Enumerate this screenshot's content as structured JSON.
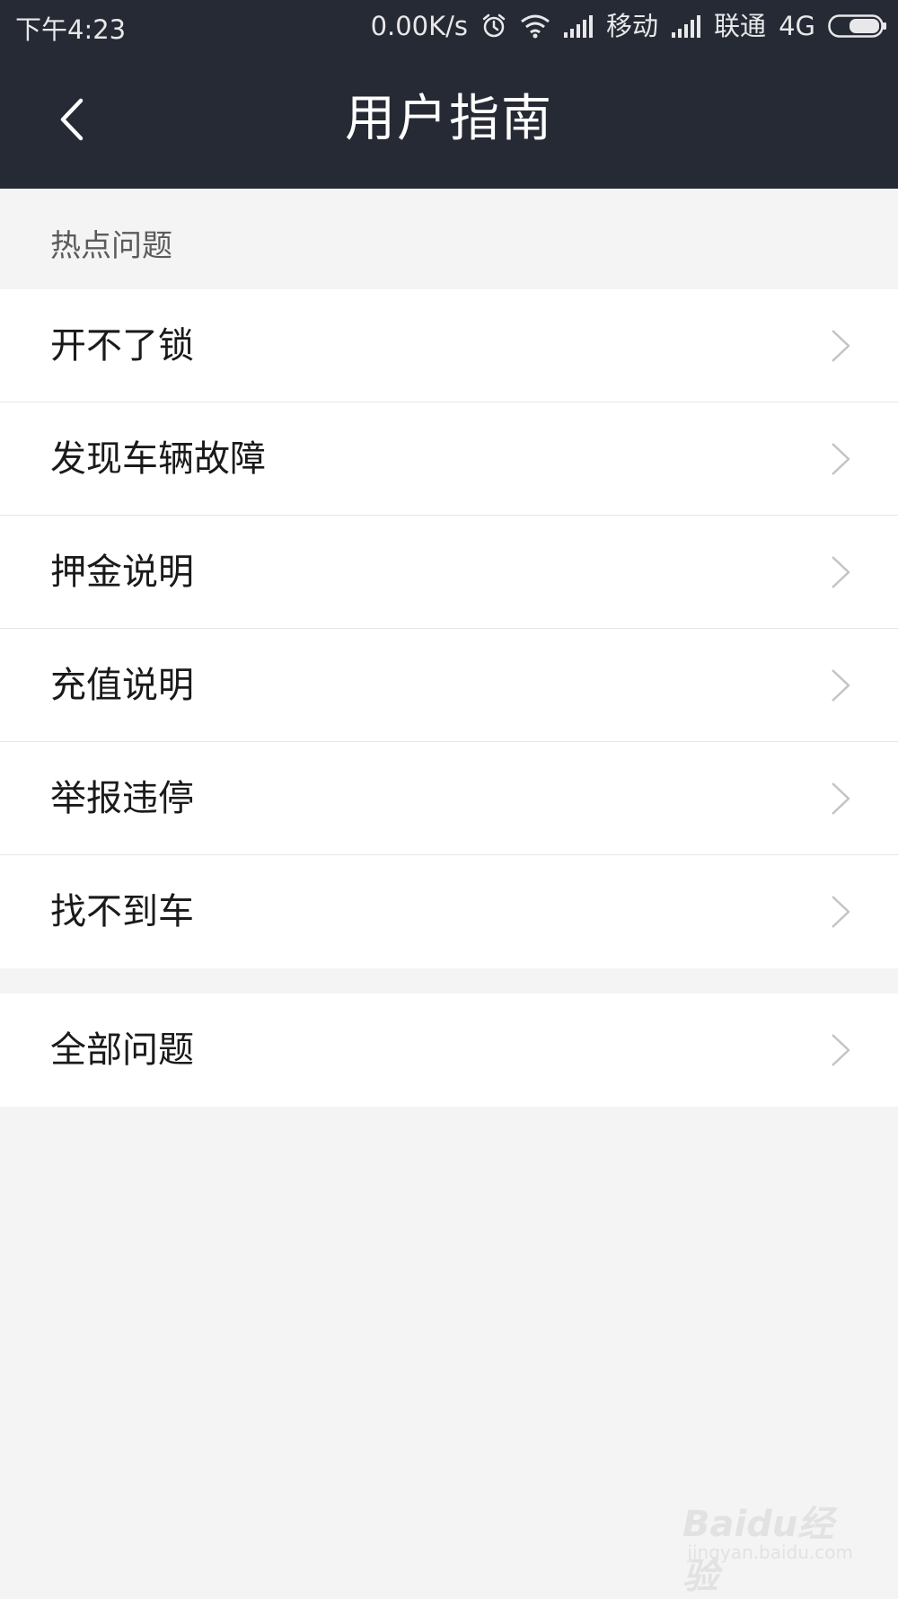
{
  "status_bar": {
    "time": "下午4:23",
    "net_speed": "0.00K/s",
    "carrier_1": "移动",
    "carrier_2": "联通",
    "network_type": "4G",
    "icons": [
      "alarm-icon",
      "wifi-icon",
      "signal-icon",
      "signal-icon",
      "battery-icon"
    ]
  },
  "nav": {
    "title": "用户指南",
    "back_icon": "chevron-left-icon"
  },
  "hot_section": {
    "header": "热点问题",
    "items": [
      {
        "label": "开不了锁"
      },
      {
        "label": "发现车辆故障"
      },
      {
        "label": "押金说明"
      },
      {
        "label": "充值说明"
      },
      {
        "label": "举报违停"
      },
      {
        "label": "找不到车"
      }
    ]
  },
  "all_section": {
    "items": [
      {
        "label": "全部问题"
      }
    ]
  },
  "watermark": {
    "logo_text": "Baidu经验",
    "url": "jingyan.baidu.com"
  },
  "colors": {
    "header_bg": "#262a34",
    "page_bg": "#f4f4f4",
    "item_bg": "#ffffff",
    "chevron": "#c4c4c4"
  }
}
